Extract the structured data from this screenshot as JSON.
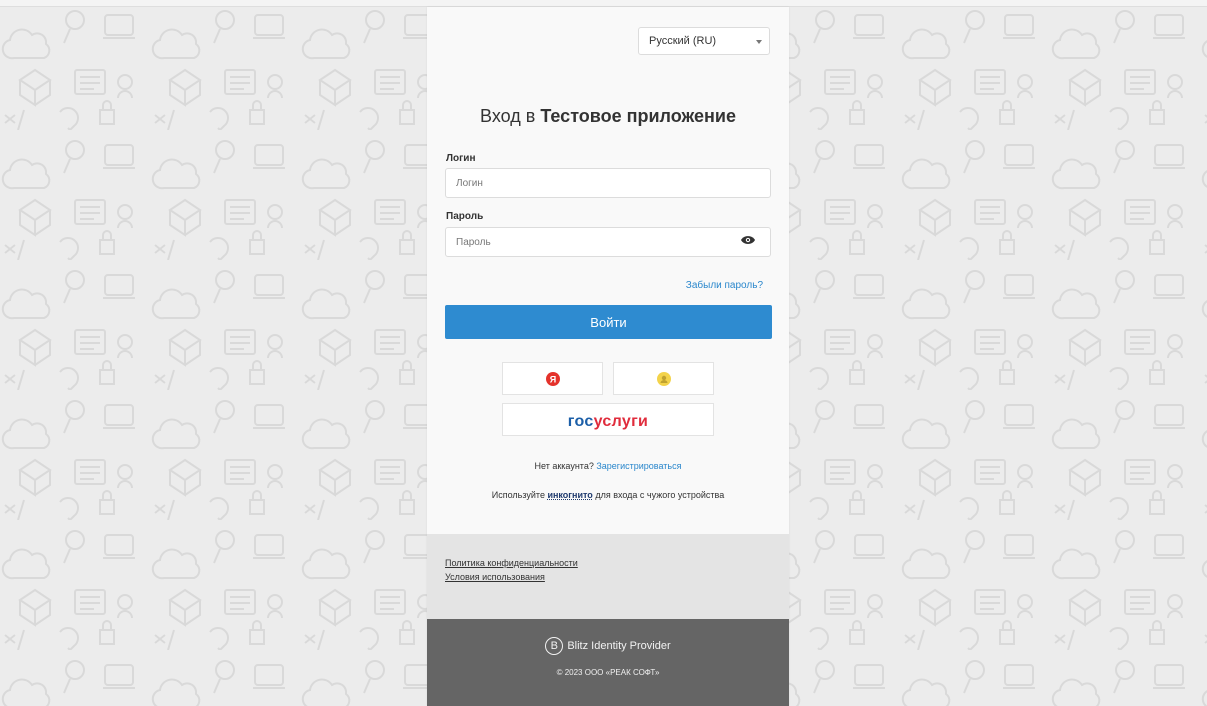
{
  "language": {
    "selected": "Русский (RU)"
  },
  "title": {
    "prefix": "Вход в ",
    "app_name": "Тестовое приложение"
  },
  "login": {
    "label": "Логин",
    "placeholder": "Логин",
    "value": ""
  },
  "password": {
    "label": "Пароль",
    "placeholder": "Пароль",
    "value": ""
  },
  "forgot_password": "Забыли пароль?",
  "submit_label": "Войти",
  "identity_providers": {
    "yandex_letter": "Я",
    "gosuslugi_part1": "гос",
    "gosuslugi_part2": "услуги"
  },
  "register": {
    "text": "Нет аккаунта?",
    "link": "Зарегистрироваться"
  },
  "incognito_hint": {
    "before": "Используйте ",
    "link": "инкогнито",
    "after": " для входа с чужого устройства"
  },
  "legal_links": {
    "privacy": "Политика конфиденциальности",
    "terms": "Условия использования"
  },
  "footer": {
    "brand": "Blitz Identity Provider",
    "copyright": "© 2023 ООО «РЕАК СОФТ»"
  },
  "colors": {
    "primary": "#2e8bd0",
    "link": "#2a87cc",
    "footer_bg": "#656565",
    "legal_bg": "#e4e4e4",
    "yandex": "#e4322b",
    "gos_blue": "#1c5fa8",
    "gos_red": "#e02c3c"
  }
}
